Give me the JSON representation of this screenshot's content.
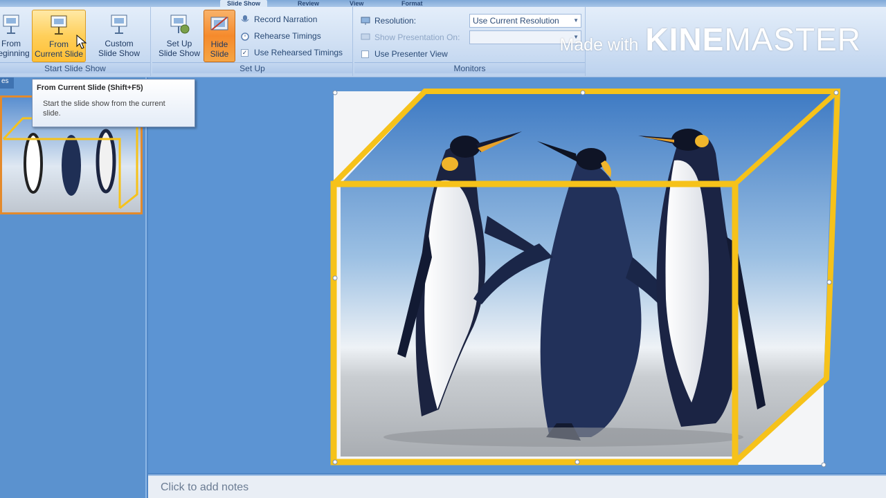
{
  "ribbon": {
    "tabs": [
      "Slide Show",
      "Review",
      "View",
      "Format"
    ],
    "start_group": {
      "label": "Start Slide Show",
      "from_beginning": "From\nBeginning",
      "from_current": "From\nCurrent Slide",
      "custom": "Custom\nSlide Show"
    },
    "setup_group": {
      "label": "Set Up",
      "setup_show": "Set Up\nSlide Show",
      "hide_slide": "Hide\nSlide",
      "record_narration": "Record Narration",
      "rehearse_timings": "Rehearse Timings",
      "use_rehearsed": "Use Rehearsed Timings"
    },
    "monitors_group": {
      "label": "Monitors",
      "resolution_label": "Resolution:",
      "resolution_value": "Use Current Resolution",
      "show_on": "Show Presentation On:",
      "presenter_view": "Use Presenter View"
    }
  },
  "watermark": {
    "made": "Made with",
    "kine": "KINE",
    "master": "MASTER"
  },
  "left_panel": {
    "tab": "es"
  },
  "tooltip": {
    "title": "From Current Slide (Shift+F5)",
    "body": "Start the slide show from the current slide."
  },
  "notes": {
    "placeholder": "Click to add notes"
  },
  "colors": {
    "accent_orange": "#f5a544",
    "frame_yellow": "#f6c21a",
    "slide_bg": "#5c94d3"
  }
}
